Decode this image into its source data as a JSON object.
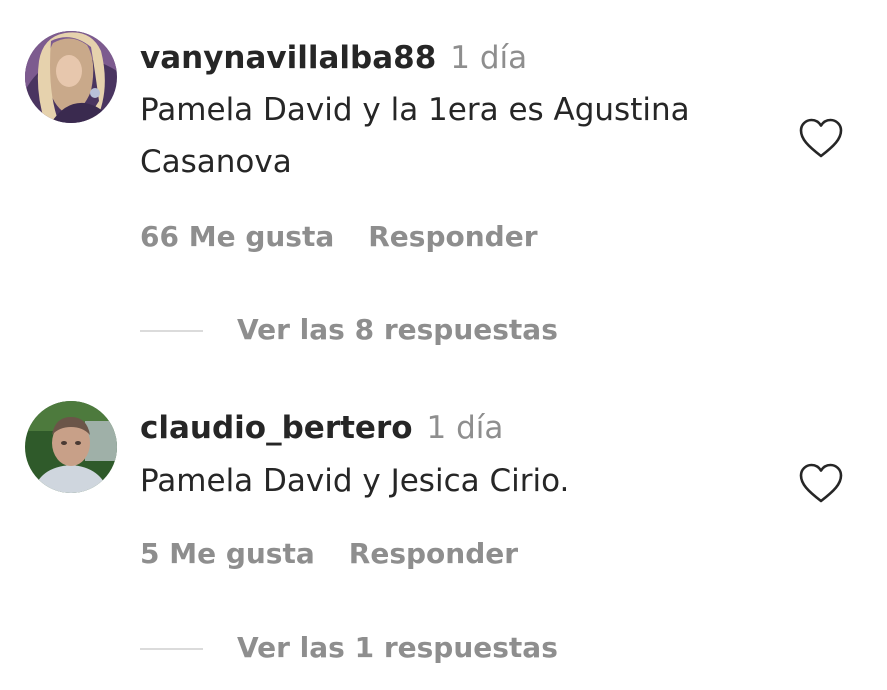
{
  "comments": [
    {
      "username": "vanynavillalba88",
      "time": "1 día",
      "text": "Pamela David y la 1era es Agustina Casanova",
      "likes": "66 Me gusta",
      "reply_label": "Responder",
      "view_replies": "Ver las 8 respuestas",
      "like_icon": "heart-outline-icon"
    },
    {
      "username": "claudio_bertero",
      "time": "1 día",
      "text": "Pamela David y Jesica Cirio.",
      "likes": "5 Me gusta",
      "reply_label": "Responder",
      "view_replies": "Ver las 1 respuestas",
      "like_icon": "heart-outline-icon"
    }
  ],
  "colors": {
    "primary_text": "#262626",
    "secondary_text": "#8e8e8e",
    "divider": "#dbdbdb",
    "background": "#ffffff"
  }
}
